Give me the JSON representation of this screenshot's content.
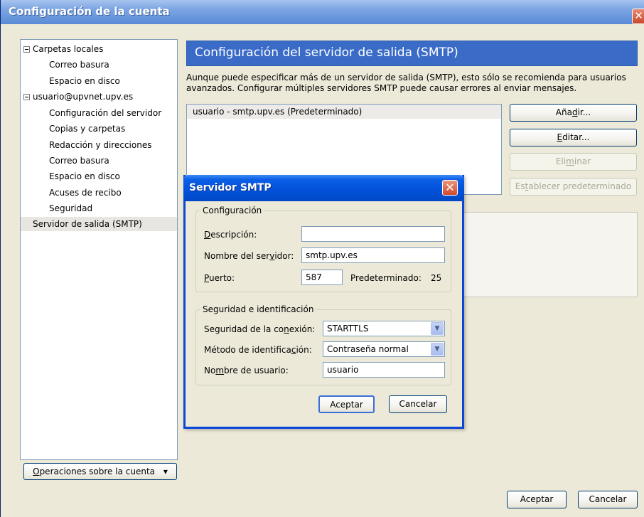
{
  "window": {
    "title": "Configuración de la cuenta",
    "close_glyph": "✕"
  },
  "tree": {
    "items": [
      {
        "label": "Carpetas locales",
        "level": 0,
        "expander": true
      },
      {
        "label": "Correo basura",
        "level": 1
      },
      {
        "label": "Espacio en disco",
        "level": 1
      },
      {
        "label": "usuario@upvnet.upv.es",
        "level": 0,
        "expander": true
      },
      {
        "label": "Configuración del servidor",
        "level": 1
      },
      {
        "label": "Copias y carpetas",
        "level": 1
      },
      {
        "label": "Redacción y direcciones",
        "level": 1
      },
      {
        "label": "Correo basura",
        "level": 1
      },
      {
        "label": "Espacio en disco",
        "level": 1
      },
      {
        "label": "Acuses de recibo",
        "level": 1
      },
      {
        "label": "Seguridad",
        "level": 1
      },
      {
        "label": "Servidor de salida (SMTP)",
        "level": 0,
        "selected": true
      }
    ]
  },
  "account_ops": {
    "label_pre": "",
    "label_u": "O",
    "label_post": "peraciones sobre la cuenta",
    "arrow": "▾"
  },
  "panel": {
    "header": "Configuración del servidor de salida (SMTP)",
    "description": "Aunque puede especificar más de un servidor de salida (SMTP), esto sólo se recomienda para usuarios avanzados. Configurar múltiples servidores SMTP puede causar errores al enviar mensajes.",
    "servers": [
      "usuario - smtp.upv.es (Predeterminado)"
    ],
    "buttons": {
      "add": {
        "pre": "Aña",
        "u": "d",
        "post": "ir..."
      },
      "edit": {
        "pre": "",
        "u": "E",
        "post": "ditar..."
      },
      "delete": {
        "pre": "Eli",
        "u": "m",
        "post": "inar"
      },
      "set_default": {
        "pre": "Es",
        "u": "t",
        "post": "ablecer predeterminado"
      }
    }
  },
  "dialog": {
    "title": "Servidor SMTP",
    "close_glyph": "✕",
    "config_group": "Configuración",
    "description": {
      "label_pre": "",
      "label_u": "D",
      "label_post": "escripción:",
      "value": ""
    },
    "server_name": {
      "label_pre": "Nombre del ser",
      "label_u": "v",
      "label_post": "idor:",
      "value": "smtp.upv.es"
    },
    "port": {
      "label_pre": "",
      "label_u": "P",
      "label_post": "uerto:",
      "value": "587",
      "default_label": "Predeterminado:",
      "default_value": "25"
    },
    "security_group": "Seguridad e identificación",
    "connection_security": {
      "label_pre": "Seguridad de la co",
      "label_u": "n",
      "label_post": "exión:",
      "value": "STARTTLS"
    },
    "auth_method": {
      "label_pre": "Método de identifica",
      "label_u": "c",
      "label_post": "ión:",
      "value": "Contraseña normal"
    },
    "username": {
      "label_pre": "No",
      "label_u": "m",
      "label_post": "bre de usuario:",
      "value": "usuario"
    },
    "ok": "Aceptar",
    "cancel": "Cancelar",
    "dropdown_arrow": "▼"
  },
  "footer": {
    "ok": "Aceptar",
    "cancel": "Cancelar"
  }
}
